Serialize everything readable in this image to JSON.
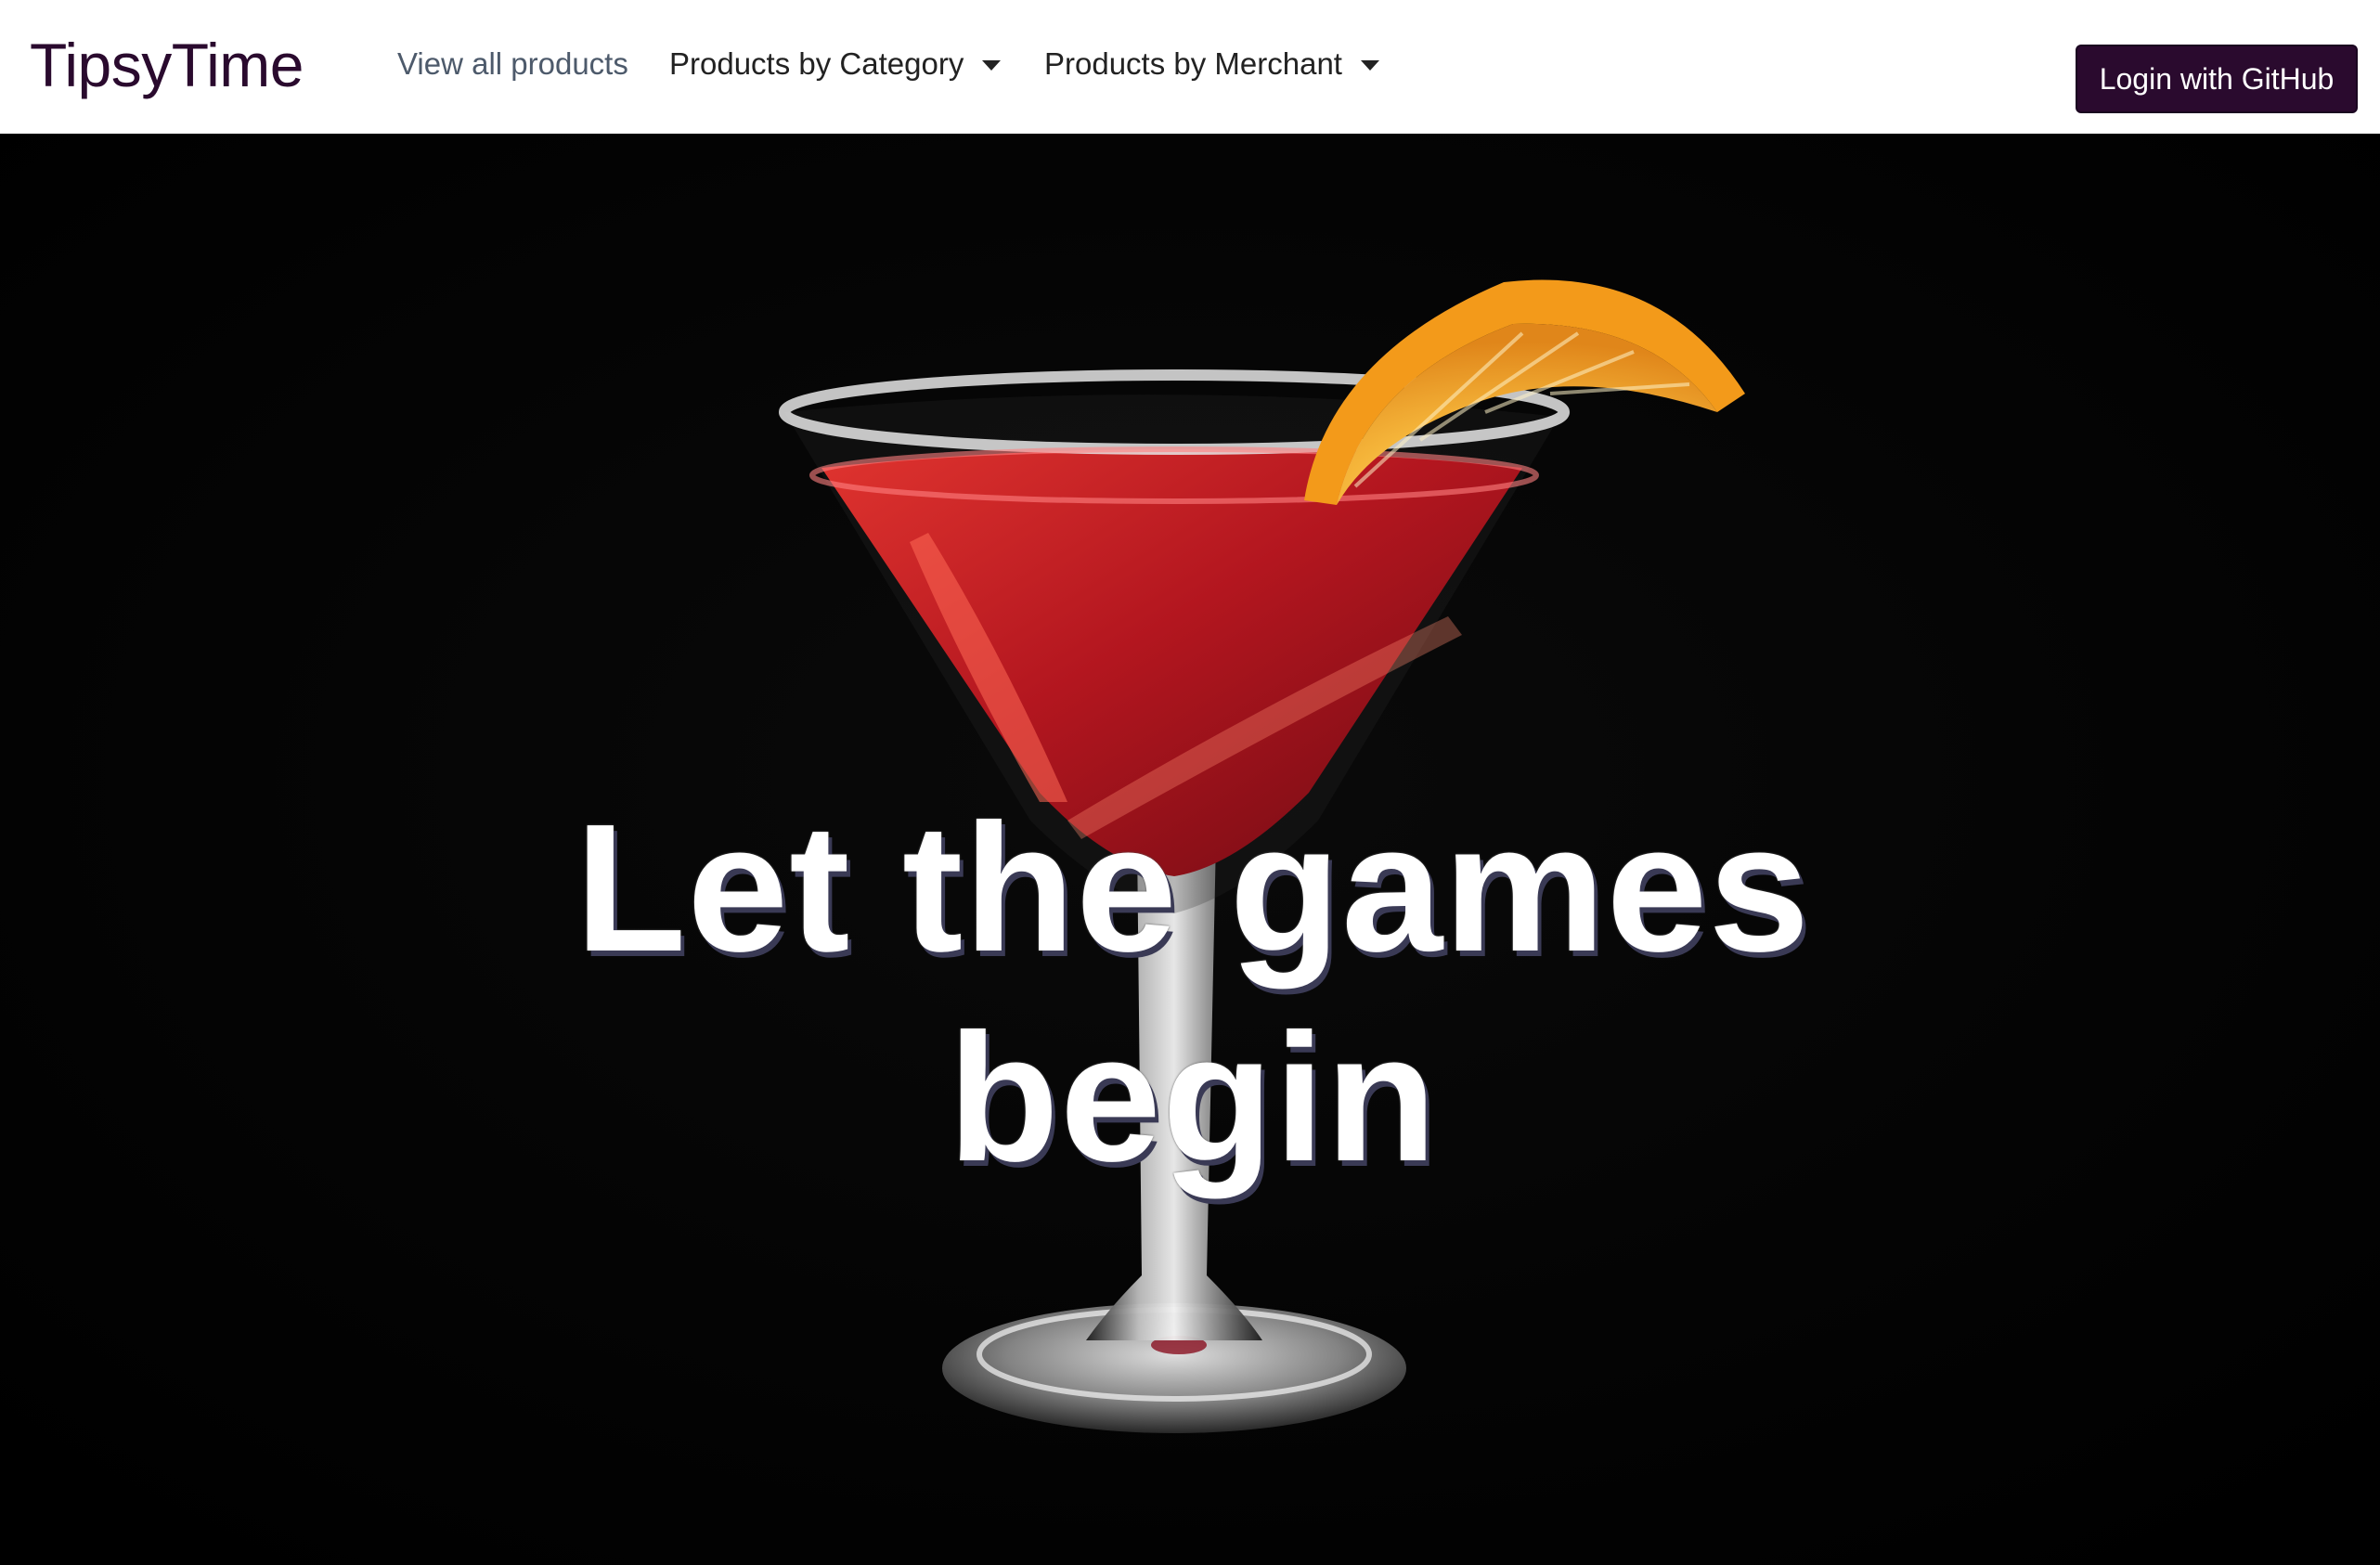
{
  "navbar": {
    "brand": "TipsyTime",
    "links": [
      {
        "label": "View all products",
        "has_dropdown": false
      },
      {
        "label": "Products by Category",
        "has_dropdown": true
      },
      {
        "label": "Products by Merchant",
        "has_dropdown": true
      }
    ],
    "login_label": "Login with GitHub"
  },
  "hero": {
    "title": "Let the games begin",
    "image_description_icon": "cocktail-glass-image"
  },
  "colors": {
    "brand": "#2a0a2e",
    "hero_bg": "#000000",
    "drink": "#c8202a",
    "orange": "#f2a22a"
  }
}
